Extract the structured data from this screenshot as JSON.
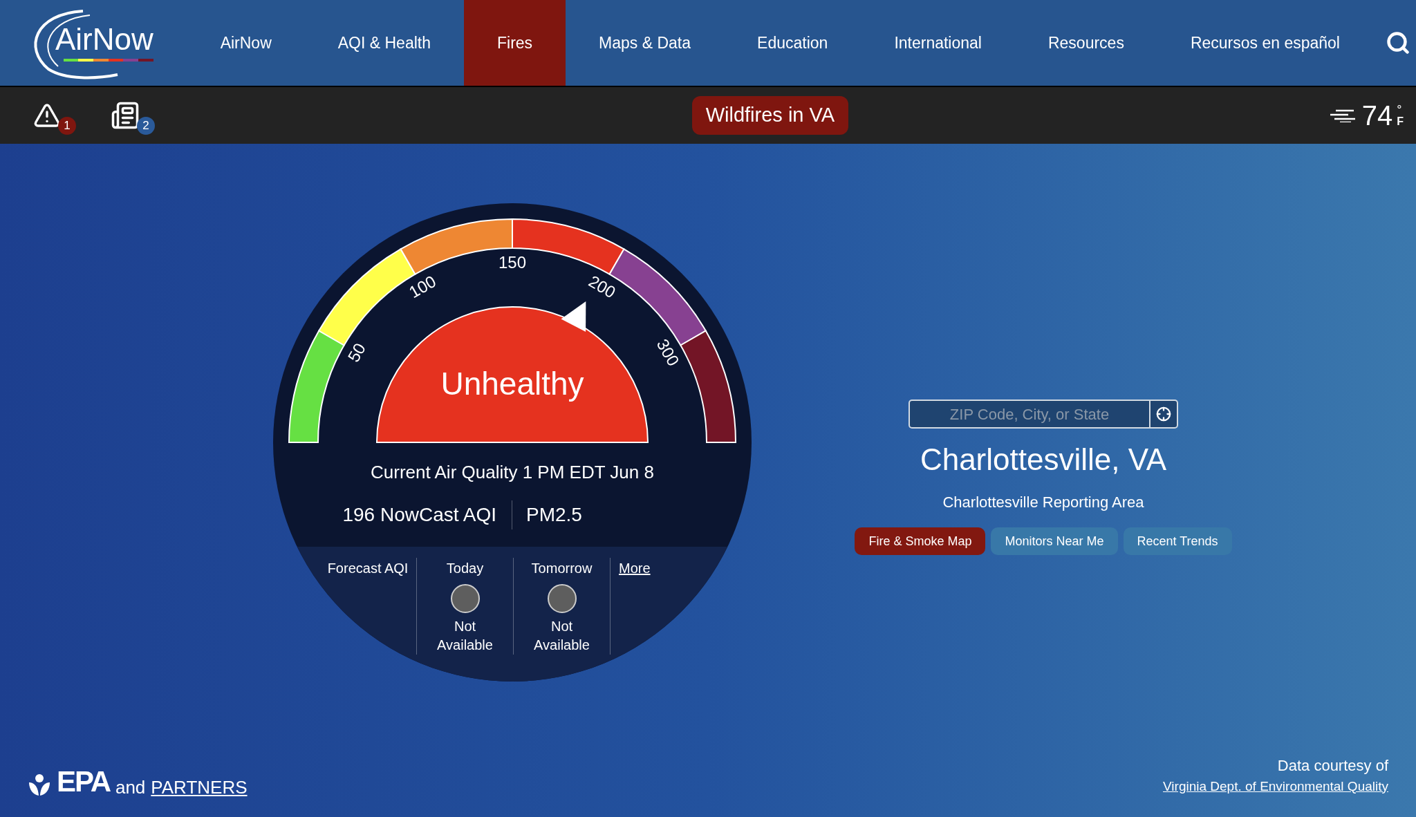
{
  "header": {
    "logo_text": "AirNow",
    "nav": [
      {
        "label": "AirNow",
        "selected": false
      },
      {
        "label": "AQI & Health",
        "selected": false
      },
      {
        "label": "Fires",
        "selected": true
      },
      {
        "label": "Maps & Data",
        "selected": false
      },
      {
        "label": "Education",
        "selected": false
      },
      {
        "label": "International",
        "selected": false
      },
      {
        "label": "Resources",
        "selected": false
      },
      {
        "label": "Recursos en español",
        "selected": false
      }
    ]
  },
  "alert_bar": {
    "alerts_count": "1",
    "news_count": "2",
    "banner": "Wildfires in VA",
    "temperature": "74",
    "degree": "°",
    "unit": "F"
  },
  "gauge": {
    "level": 0.653,
    "ticks": [
      "50",
      "100",
      "150",
      "200",
      "300"
    ],
    "category": "Unhealthy",
    "current": "Current Air Quality 1 PM EDT Jun 8",
    "aqi": "196 NowCast AQI",
    "pollutant": "PM2.5"
  },
  "forecast": {
    "label": "Forecast AQI",
    "days": [
      {
        "day": "Today",
        "status": "Not Available",
        "color": "#5e5e5e"
      },
      {
        "day": "Tomorrow",
        "status": "Not Available",
        "color": "#5e5e5e"
      }
    ],
    "more": "More"
  },
  "location": {
    "placeholder": "ZIP Code, City, or State",
    "city": "Charlottesville, VA",
    "area": "Charlottesville Reporting Area",
    "buttons": [
      {
        "label": "Fire & Smoke Map",
        "kind": "primary"
      },
      {
        "label": "Monitors Near Me",
        "kind": "secondary"
      },
      {
        "label": "Recent Trends",
        "kind": "secondary"
      }
    ]
  },
  "footer": {
    "logo_text": "EPA",
    "and": "and",
    "partners": "PARTNERS",
    "courtesy": "Data courtesy of",
    "agency": "Virginia Dept. of Environmental Quality"
  }
}
